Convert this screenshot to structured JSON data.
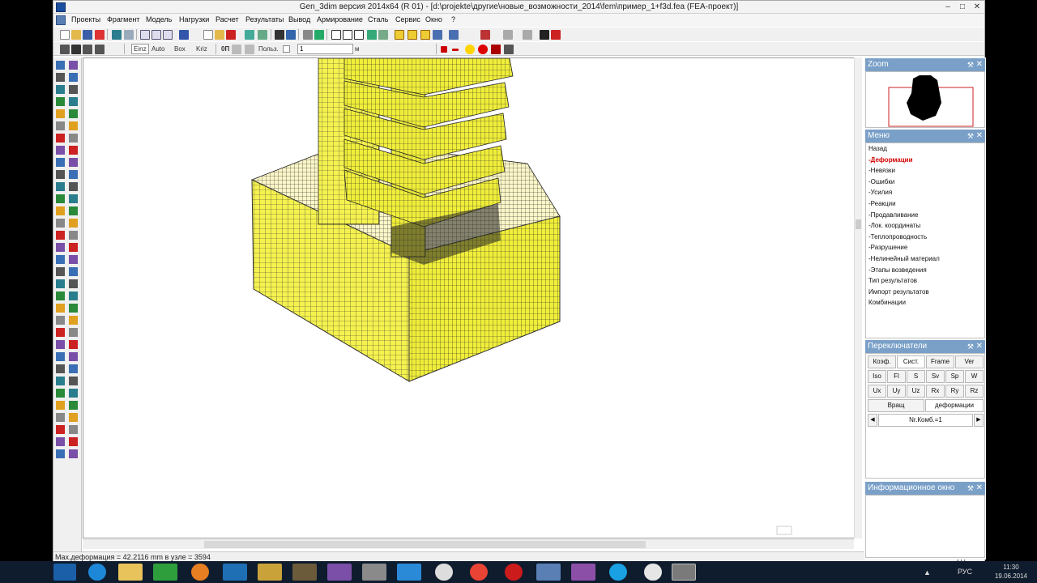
{
  "window": {
    "title": "Gen_3dim версия 2014x64 (R 01) - [d:\\projekte\\другие\\новые_возможности_2014\\fem\\пример_1+f3d.fea  (FEA-проект)]",
    "minimize": "–",
    "maximize": "□",
    "close": "✕"
  },
  "menubar": {
    "items": [
      "Проекты",
      "Фрагмент",
      "Модель",
      "Нагрузки",
      "Расчет",
      "Результаты",
      "Вывод",
      "Армирование",
      "Сталь",
      "Сервис",
      "Окно",
      "?"
    ]
  },
  "toolbar2": {
    "mode_buttons": [
      "Einz",
      "Auto",
      "Box",
      "Kriz"
    ],
    "toggle_label": "0П",
    "user_label": "Польз.",
    "value": "1",
    "unit": "м"
  },
  "panels": {
    "zoom": {
      "title": "Zoom"
    },
    "menu": {
      "title": "Меню",
      "items": [
        "Назад",
        "-Деформации",
        "-Невязки",
        "-Ошибки",
        "-Усилия",
        "-Реакции",
        "-Продавливание",
        "-Лок. координаты",
        "-Теплопроводность",
        "-Разрушение",
        "-Нелинейный материал",
        "-Этапы возведения",
        "Тип результатов",
        "Импорт результатов",
        "Комбинации"
      ]
    },
    "switches": {
      "title": "Переключатели",
      "row1": [
        "Коэф.",
        "Сист.",
        "Frame",
        "Ver"
      ],
      "row2": [
        "Iso",
        "Fl",
        "S",
        "Sv",
        "Sp",
        "W"
      ],
      "row3": [
        "Ux",
        "Uy",
        "Uz",
        "Rx",
        "Ry",
        "Rz"
      ],
      "row4": [
        "Вращ",
        "деформации"
      ],
      "combo": "Nr.Комб.=1"
    },
    "info": {
      "title": "Информационное окно"
    }
  },
  "statusbar": {
    "left": "Max.деформация = 42.2116 mm  в узле = 3594",
    "right": "Координаты"
  },
  "taskbar": {
    "lang": "РУС",
    "time": "11:30",
    "date": "19.06.2014"
  }
}
